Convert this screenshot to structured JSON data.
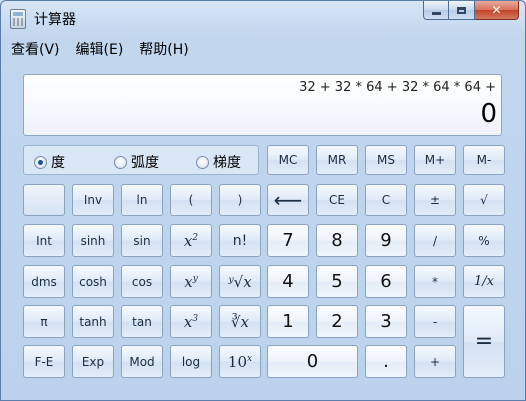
{
  "window": {
    "title": "计算器"
  },
  "menu": [
    "查看(V)",
    "编辑(E)",
    "帮助(H)"
  ],
  "display": {
    "expression": "32 + 32 * 64 + 32 * 64 * 64 +",
    "value": "0"
  },
  "angle": {
    "options": [
      "度",
      "弧度",
      "梯度"
    ],
    "selected": "度"
  },
  "memory_buttons": [
    "MC",
    "MR",
    "MS",
    "M+",
    "M-"
  ],
  "buttons": {
    "inv": "Inv",
    "ln": "ln",
    "lparen": "(",
    "rparen": ")",
    "backspace": "⟵",
    "ce": "CE",
    "clear": "C",
    "plusminus": "±",
    "sqrt": "√",
    "int": "Int",
    "sinh": "sinh",
    "sin": "sin",
    "x2_base": "x",
    "x2_exp": "2",
    "fact": "n!",
    "n7": "7",
    "n8": "8",
    "n9": "9",
    "div": "/",
    "pct": "%",
    "dms": "dms",
    "cosh": "cosh",
    "cos": "cos",
    "xy_base": "x",
    "xy_exp": "y",
    "yroot": "ʸ√x",
    "n4": "4",
    "n5": "5",
    "n6": "6",
    "mul": "*",
    "recip": "1/x",
    "pi": "π",
    "tanh": "tanh",
    "tan": "tan",
    "x3_base": "x",
    "x3_exp": "3",
    "cbrt": "∛x",
    "n1": "1",
    "n2": "2",
    "n3": "3",
    "sub": "-",
    "equals": "=",
    "fe": "F-E",
    "exp": "Exp",
    "mod": "Mod",
    "log": "log",
    "ten_base": "10",
    "ten_exp": "x",
    "n0": "0",
    "dot": ".",
    "add": "+"
  }
}
